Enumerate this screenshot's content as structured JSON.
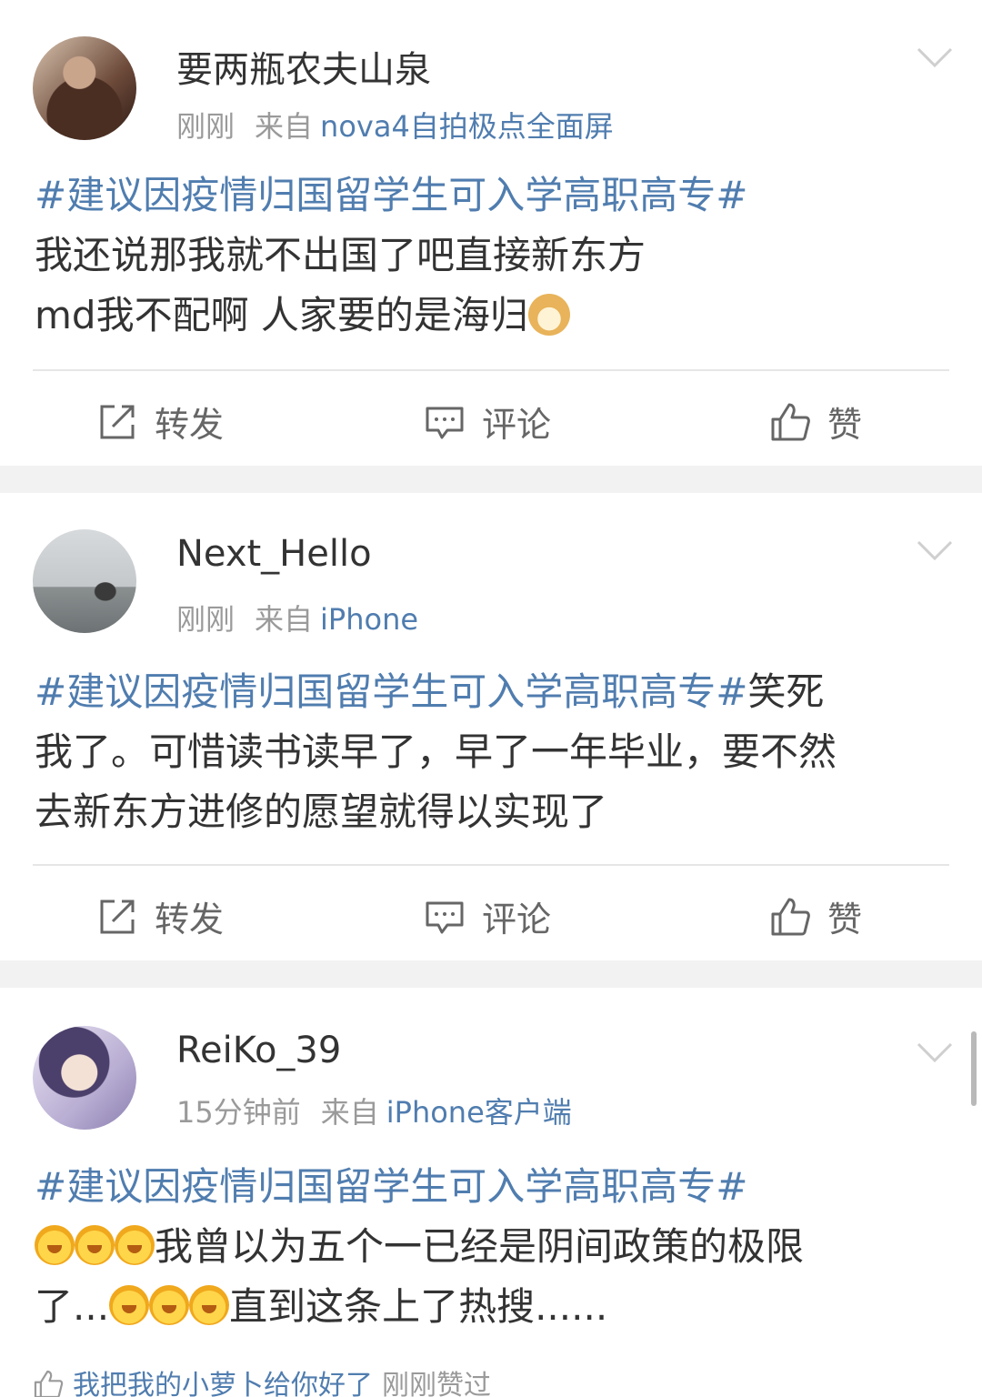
{
  "posts": [
    {
      "username": "要两瓶农夫山泉",
      "time": "刚刚",
      "from_label": "来自",
      "source": "nova4自拍极点全面屏",
      "hashtag": "#建议因疫情归国留学生可入学高职高专#",
      "text_line1": "我还说那我就不出国了吧直接新东方",
      "text_line2": "md我不配啊 人家要的是海归",
      "emoji": "doge",
      "actions": {
        "repost": "转发",
        "comment": "评论",
        "like": "赞"
      }
    },
    {
      "username": "Next_Hello",
      "time": "刚刚",
      "from_label": "来自",
      "source": "iPhone",
      "hashtag": "#建议因疫情归国留学生可入学高职高专#",
      "text_after_tag": "笑死",
      "text_line2": "我了。可惜读书读早了，早了一年毕业，要不然",
      "text_line3": "去新东方进修的愿望就得以实现了",
      "actions": {
        "repost": "转发",
        "comment": "评论",
        "like": "赞"
      }
    },
    {
      "username": "ReiKo_39",
      "time": "15分钟前",
      "from_label": "来自",
      "source": "iPhone客户端",
      "hashtag": "#建议因疫情归国留学生可入学高职高专#",
      "text_line2": "我曾以为五个一已经是阴间政策的极限",
      "text_line3_a": "了...",
      "text_line3_b": "直到这条上了热搜......",
      "emoji": "grin-emoji",
      "liked_by": "我把我的小萝卜给你好了",
      "liked_when": "刚刚赞过"
    }
  ],
  "colors": {
    "link": "#507daf",
    "meta": "#9a9a9a",
    "text": "#333333",
    "separator": "#f2f2f2"
  }
}
